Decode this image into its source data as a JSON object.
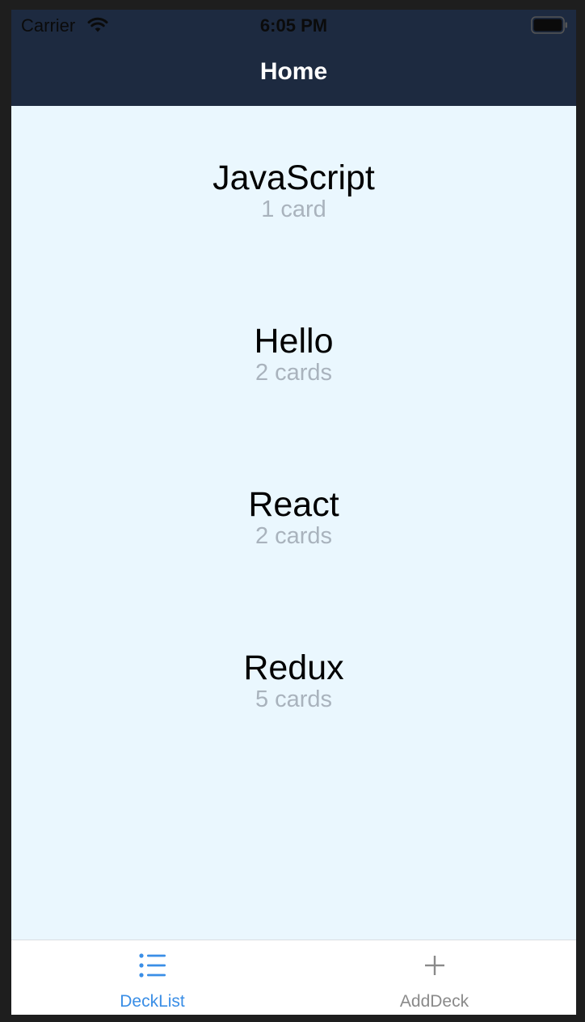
{
  "status_bar": {
    "carrier": "Carrier",
    "time": "6:05 PM",
    "wifi_icon": "wifi-icon",
    "battery_icon": "battery-icon"
  },
  "nav": {
    "title": "Home"
  },
  "decks": [
    {
      "title": "JavaScript",
      "count": "1 card"
    },
    {
      "title": "Hello",
      "count": "2 cards"
    },
    {
      "title": "React",
      "count": "2 cards"
    },
    {
      "title": "Redux",
      "count": "5 cards"
    }
  ],
  "tabs": [
    {
      "label": "DeckList",
      "icon": "list-icon",
      "active": true
    },
    {
      "label": "AddDeck",
      "icon": "plus-icon",
      "active": false
    }
  ],
  "colors": {
    "header_bg": "#1d2a40",
    "content_bg": "#eaf7fe",
    "active_tab": "#3a8ee6",
    "inactive_tab": "#8a8a8a",
    "subtitle": "#a9b3bd"
  }
}
